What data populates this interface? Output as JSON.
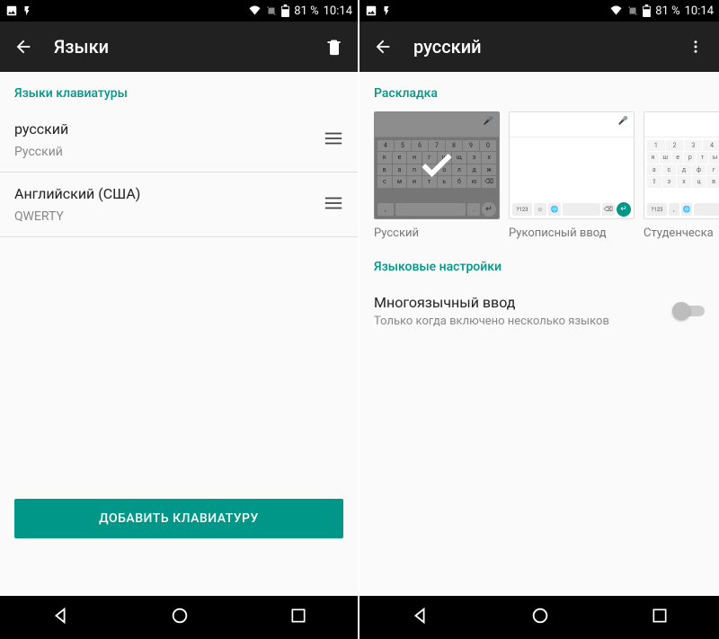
{
  "status": {
    "battery": "81 %",
    "time": "10:14"
  },
  "left": {
    "title": "Языки",
    "section": "Языки клавиатуры",
    "items": [
      {
        "name": "русский",
        "layout": "Русский"
      },
      {
        "name": "Английский (США)",
        "layout": "QWERTY"
      }
    ],
    "add_button": "ДОБАВИТЬ КЛАВИАТУРУ"
  },
  "right": {
    "title": "русский",
    "section_layout": "Раскладка",
    "layouts": [
      {
        "label": "Русский",
        "selected": true
      },
      {
        "label": "Рукописный ввод",
        "selected": false
      },
      {
        "label": "Студенческа",
        "selected": false
      }
    ],
    "section_settings": "Языковые настройки",
    "multilang": {
      "title": "Многоязычный ввод",
      "subtitle": "Только когда включено несколько языков",
      "enabled": false
    }
  },
  "colors": {
    "teal": "#009688"
  }
}
